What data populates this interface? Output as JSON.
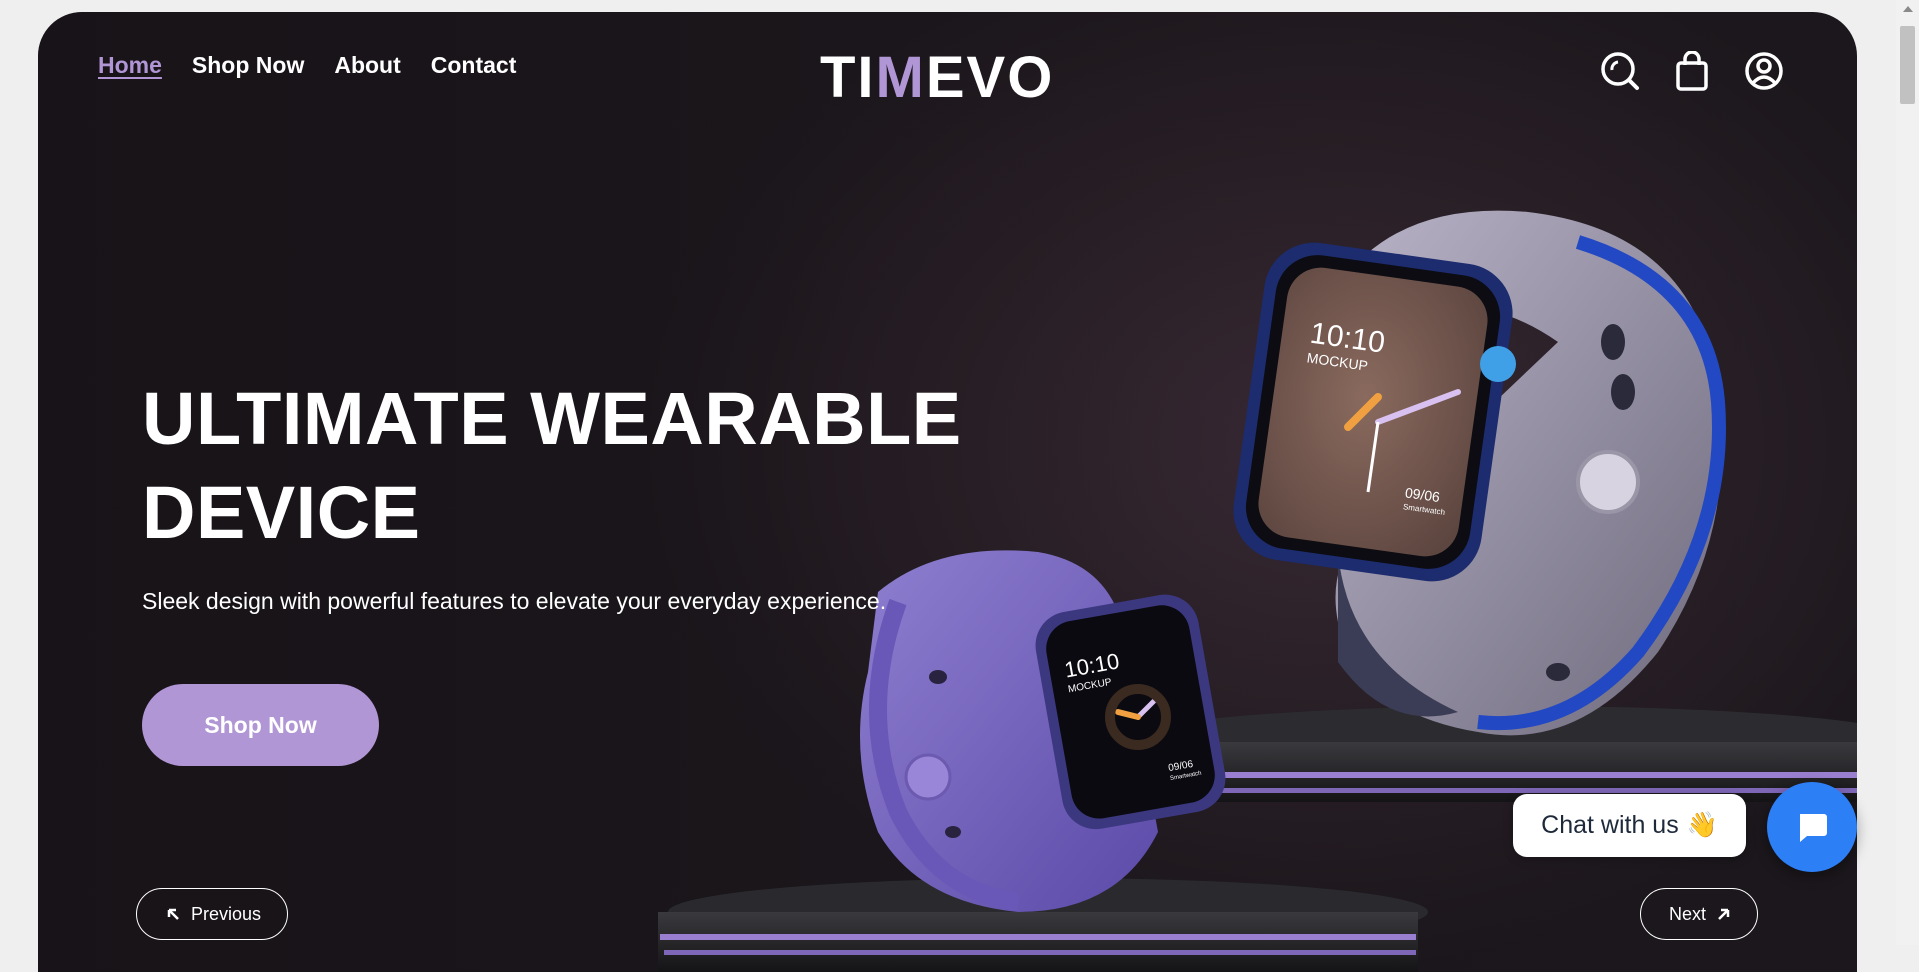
{
  "nav": {
    "items": [
      {
        "label": "Home",
        "active": true
      },
      {
        "label": "Shop Now",
        "active": false
      },
      {
        "label": "About",
        "active": false
      },
      {
        "label": "Contact",
        "active": false
      }
    ]
  },
  "brand": {
    "logo_before": "TI",
    "logo_accent": "M",
    "logo_after": "EVO",
    "accent_color": "#b196d6"
  },
  "header_icons": [
    "search-icon",
    "shopping-bag-icon",
    "user-account-icon"
  ],
  "hero": {
    "headline_line1": "ULTIMATE WEARABLE",
    "headline_line2": "DEVICE",
    "subheadline": "Sleek design with powerful features to elevate your everyday experience.",
    "cta_label": "Shop Now"
  },
  "slider": {
    "prev_label": "Previous",
    "next_label": "Next"
  },
  "watch_large": {
    "time": "10:10",
    "label": "MOCKUP",
    "date": "09/06",
    "caption": "Smartwatch"
  },
  "watch_small": {
    "time": "10:10",
    "label": "MOCKUP",
    "date": "09/06",
    "caption": "Smartwatch"
  },
  "chat": {
    "label": "Chat with us",
    "emoji": "👋",
    "button_color": "#2d7ff5"
  }
}
